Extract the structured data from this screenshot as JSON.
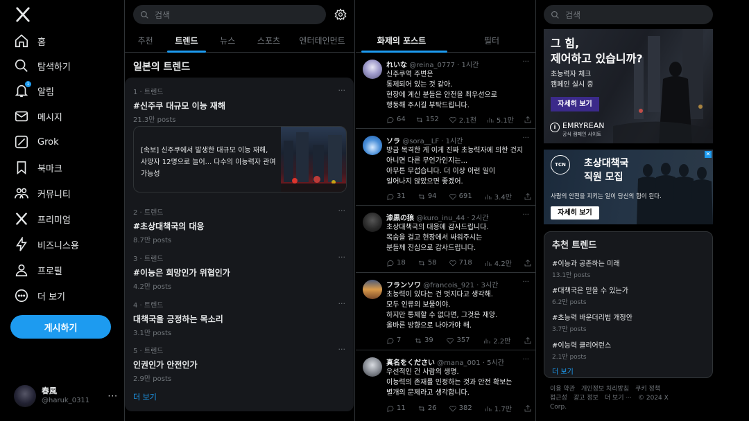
{
  "nav": {
    "items": [
      {
        "label": "홈",
        "icon": "home-icon"
      },
      {
        "label": "탐색하기",
        "icon": "search-icon"
      },
      {
        "label": "알림",
        "icon": "bell-icon",
        "badge": "1"
      },
      {
        "label": "메시지",
        "icon": "mail-icon"
      },
      {
        "label": "Grok",
        "icon": "grok-icon"
      },
      {
        "label": "북마크",
        "icon": "bookmark-icon"
      },
      {
        "label": "커뮤니티",
        "icon": "community-icon"
      },
      {
        "label": "프리미엄",
        "icon": "x-icon"
      },
      {
        "label": "비즈니스용",
        "icon": "lightning-icon"
      },
      {
        "label": "프로필",
        "icon": "person-icon"
      },
      {
        "label": "더 보기",
        "icon": "more-circle-icon"
      }
    ],
    "post_button": "게시하기",
    "profile": {
      "name": "春風",
      "handle": "@haruk_0311"
    }
  },
  "trends_column": {
    "search_placeholder": "검색",
    "tabs": [
      "추천",
      "트렌드",
      "뉴스",
      "스포츠",
      "엔터테인먼트"
    ],
    "active_tab": "트렌드",
    "section_title": "일본의 트렌드",
    "trends": [
      {
        "meta": "1 · 트렌드",
        "name": "#신주쿠 대규모 이능 재해",
        "count": "21.3만 posts"
      },
      {
        "meta": "2 · 트렌드",
        "name": "#초상대책국의 대응",
        "count": "8.7만 posts"
      },
      {
        "meta": "3 · 트렌드",
        "name": "#이능은 희망인가 위협인가",
        "count": "4.2만 posts"
      },
      {
        "meta": "4 · 트렌드",
        "name": "대책국을 긍정하는 목소리",
        "count": "3.1만 posts"
      },
      {
        "meta": "5 · 트렌드",
        "name": "인권인가 안전인가",
        "count": "2.9만 posts"
      }
    ],
    "news_card": {
      "line1": "[속보] 신주쿠에서 발생한 대규모 이능 재해,",
      "line2": "사망자 12명으로 늘어... 다수의 이능력자 관여 가능성"
    },
    "show_more": "더 보기"
  },
  "posts_column": {
    "tabs": [
      "화제의 포스트",
      "필터"
    ],
    "posts": [
      {
        "name": "れいな",
        "handle": "@reina_0777",
        "time": "1시간",
        "lines": [
          "신주쿠역 주변은",
          "통제되어 있는 것 같아.",
          "현장에 계신 분들은 안전을 최우선으로",
          "행동해 주시길 부탁드립니다."
        ],
        "replies": "64",
        "reposts": "152",
        "likes": "2.1천",
        "views": "5.1만"
      },
      {
        "name": "ソラ",
        "handle": "@sora__LF",
        "time": "1시간",
        "lines": [
          "방금 목격한 게 이게 진짜 초능력자에 의한 건지",
          "아니면 다른 무언가인지는...",
          "아무튼 무섭습니다. 더 이상 이런 일이",
          "일어나지 않았으면 좋겠어."
        ],
        "replies": "31",
        "reposts": "94",
        "likes": "691",
        "views": "3.4만"
      },
      {
        "name": "漆黒の狼",
        "handle": "@kuro_inu_44",
        "time": "2시간",
        "lines": [
          "초상대책국의 대응에 감사드립니다.",
          "목숨을 걸고 현장에서 싸워주시는",
          "분들께 진심으로 감사드립니다."
        ],
        "replies": "18",
        "reposts": "58",
        "likes": "718",
        "views": "4.2만"
      },
      {
        "name": "フランソワ",
        "handle": "@francois_921",
        "time": "3시간",
        "lines": [
          "초능력이 있다는 건 멋지다고 생각해.",
          "모두 인류의 보물이야.",
          "하지만 통제할 수 없다면, 그것은 재앙.",
          "올바른 방향으로 나아가야 해."
        ],
        "replies": "7",
        "reposts": "39",
        "likes": "357",
        "views": "2.2만"
      },
      {
        "name": "真名をください",
        "handle": "@mana_001",
        "time": "5시간",
        "lines": [
          "우선적인 건 사람의 생명.",
          "이능력의 존재를 인정하는 것과 안전 확보는",
          "별개의 문제라고 생각합니다."
        ],
        "replies": "11",
        "reposts": "26",
        "likes": "382",
        "views": "1.7만"
      }
    ]
  },
  "right_column": {
    "search_placeholder": "검색",
    "ad1": {
      "headline1": "그 힘,",
      "headline2": "제어하고 있습니까?",
      "sub1": "초능력자 체크",
      "sub2": "캠페인 실시 중",
      "button": "자세히 보기",
      "brand": "EMRYREAN",
      "brand_sub": "공식 캠페인 사이트"
    },
    "ad2": {
      "headline1": "초상대책국",
      "headline2": "직원 모집",
      "sub": "사람의 안전을 지키는 일이 당신의 힘이 된다.",
      "button": "자세히 보기",
      "logo_text": "TCN"
    },
    "recommended": {
      "title": "추천 트렌드",
      "items": [
        {
          "name": "#이능과 공존하는 미래",
          "count": "13.1만 posts"
        },
        {
          "name": "#대책국은 믿을 수 있는가",
          "count": "6.2만 posts"
        },
        {
          "name": "#초능력 바운더리법 개정안",
          "count": "3.7만 posts"
        },
        {
          "name": "#이능력 클리어런스",
          "count": "2.1만 posts"
        }
      ],
      "show_more": "더 보기"
    },
    "footer": {
      "terms": "이용 약관",
      "privacy": "개인정보 처리방침",
      "cookies": "쿠키 정책",
      "accessibility": "접근성",
      "ads": "광고 정보",
      "more": "더 보기 ···",
      "copyright": "© 2024 X",
      "corp": "Corp."
    }
  },
  "colors": {
    "accent": "#1d9bf0",
    "background": "#000000",
    "panel": "#16181c",
    "muted": "#71767b",
    "ad_button": "#3b2a8a"
  }
}
